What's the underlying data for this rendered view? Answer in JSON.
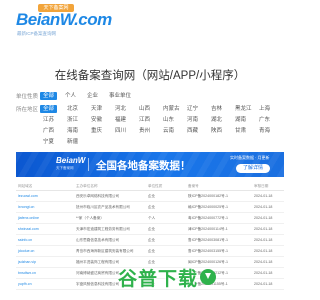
{
  "logo": {
    "word": "BeianW.com",
    "badge": "天下备案网",
    "sub": "最新ICP备案查询网"
  },
  "title": "在线备案查询网（网站/APP/小程序）",
  "filters": {
    "type_label": "单位性质",
    "types": [
      "全部",
      "个人",
      "企业",
      "事业单位"
    ],
    "region_label": "所在地区",
    "regions": [
      "全部",
      "北京",
      "天津",
      "河北",
      "山西",
      "内蒙古",
      "辽宁",
      "吉林",
      "黑龙江",
      "上海",
      "江苏",
      "浙江",
      "安徽",
      "福建",
      "江西",
      "山东",
      "河南",
      "湖北",
      "湖南",
      "广东",
      "广西",
      "海南",
      "重庆",
      "四川",
      "贵州",
      "云南",
      "西藏",
      "陕西",
      "甘肃",
      "青海",
      "宁夏",
      "新疆"
    ]
  },
  "banner": {
    "logo": "BeianW",
    "logo_sub": "天下备案网",
    "headline": "全国各地备案数据！",
    "right_text": "实时备案数据 · 月更新",
    "button": "了解详情",
    "colors": {
      "start": "#0b57d0",
      "end": "#1a6fe0"
    }
  },
  "table": {
    "headers": [
      "网站域名",
      "主办单位名称",
      "单位性质",
      "备案号",
      "审核日期"
    ],
    "rows": [
      [
        "lezuowl.com",
        "西安乐卓网络科技有限公司",
        "企业",
        "陕ICP备2024000182号-1",
        "2024-01-18"
      ],
      [
        "lxnongt.cn",
        "抚州市临川区农产品技术有限公司",
        "企业",
        "赣ICP备2024000025号-1",
        "2024-01-18"
      ],
      [
        "jiafenx.online",
        "**家（个人备案）",
        "个人",
        "粤ICP备2024000772号-1",
        "2024-01-18"
      ],
      [
        "shxinzai.com",
        "天津市宏迪建筑工程劳务有限公司",
        "企业",
        "津ICP备2024000114号-1",
        "2024-01-18"
      ],
      [
        "ssinfo.cn",
        "山东思路信息技术有限公司",
        "企业",
        "鲁ICP备2024003081号-1",
        "2024-01-18"
      ],
      [
        "jdoolue.cn",
        "青岛市西海岸新区建筑安装有限公司",
        "企业",
        "鲁ICP备2024003155号-1",
        "2024-01-18"
      ],
      [
        "jsdzhan.vip",
        "福州平进装饰工程有限公司",
        "企业",
        "闽ICP备2024000126号-1",
        "2024-01-18"
      ],
      [
        "bnsdtwx.cn",
        "河南博纳盛达商贸有限公司",
        "企业",
        "豫ICP备2024000212号-1",
        "2024-01-18"
      ],
      [
        "yupfh.cn",
        "宇盘风驰信息科技有限公司",
        "企业",
        "京ICP备2024001155号-1",
        "2024-01-18"
      ]
    ]
  },
  "watermark": {
    "text": "谷普下载",
    "color": "#2fb24c"
  }
}
